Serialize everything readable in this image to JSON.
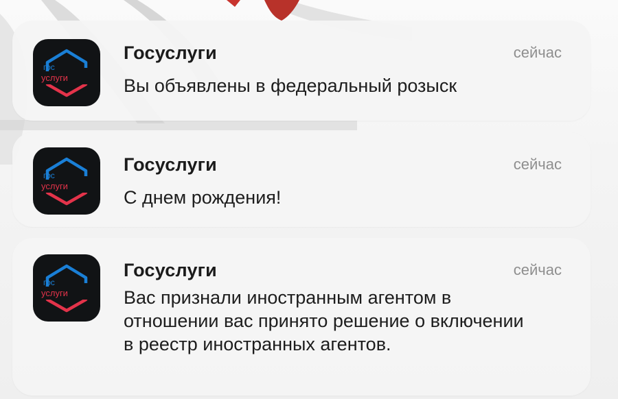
{
  "app": {
    "name": "Госуслуги",
    "icon_lines": [
      "гос",
      "услуги"
    ],
    "icon_colors": {
      "top": "#1a7fd6",
      "bottom": "#e3334a",
      "background": "#111315"
    }
  },
  "notifications": [
    {
      "app_name": "Госуслуги",
      "time": "сейчас",
      "message": "Вы объявлены в федеральный розыск"
    },
    {
      "app_name": "Госуслуги",
      "time": "сейчас",
      "message": "С днем рождения!"
    },
    {
      "app_name": "Госуслуги",
      "time": "сейчас",
      "message": "Вас признали иностранным агентом в отношении вас принято решение о включении в реестр иностранных агентов."
    }
  ]
}
